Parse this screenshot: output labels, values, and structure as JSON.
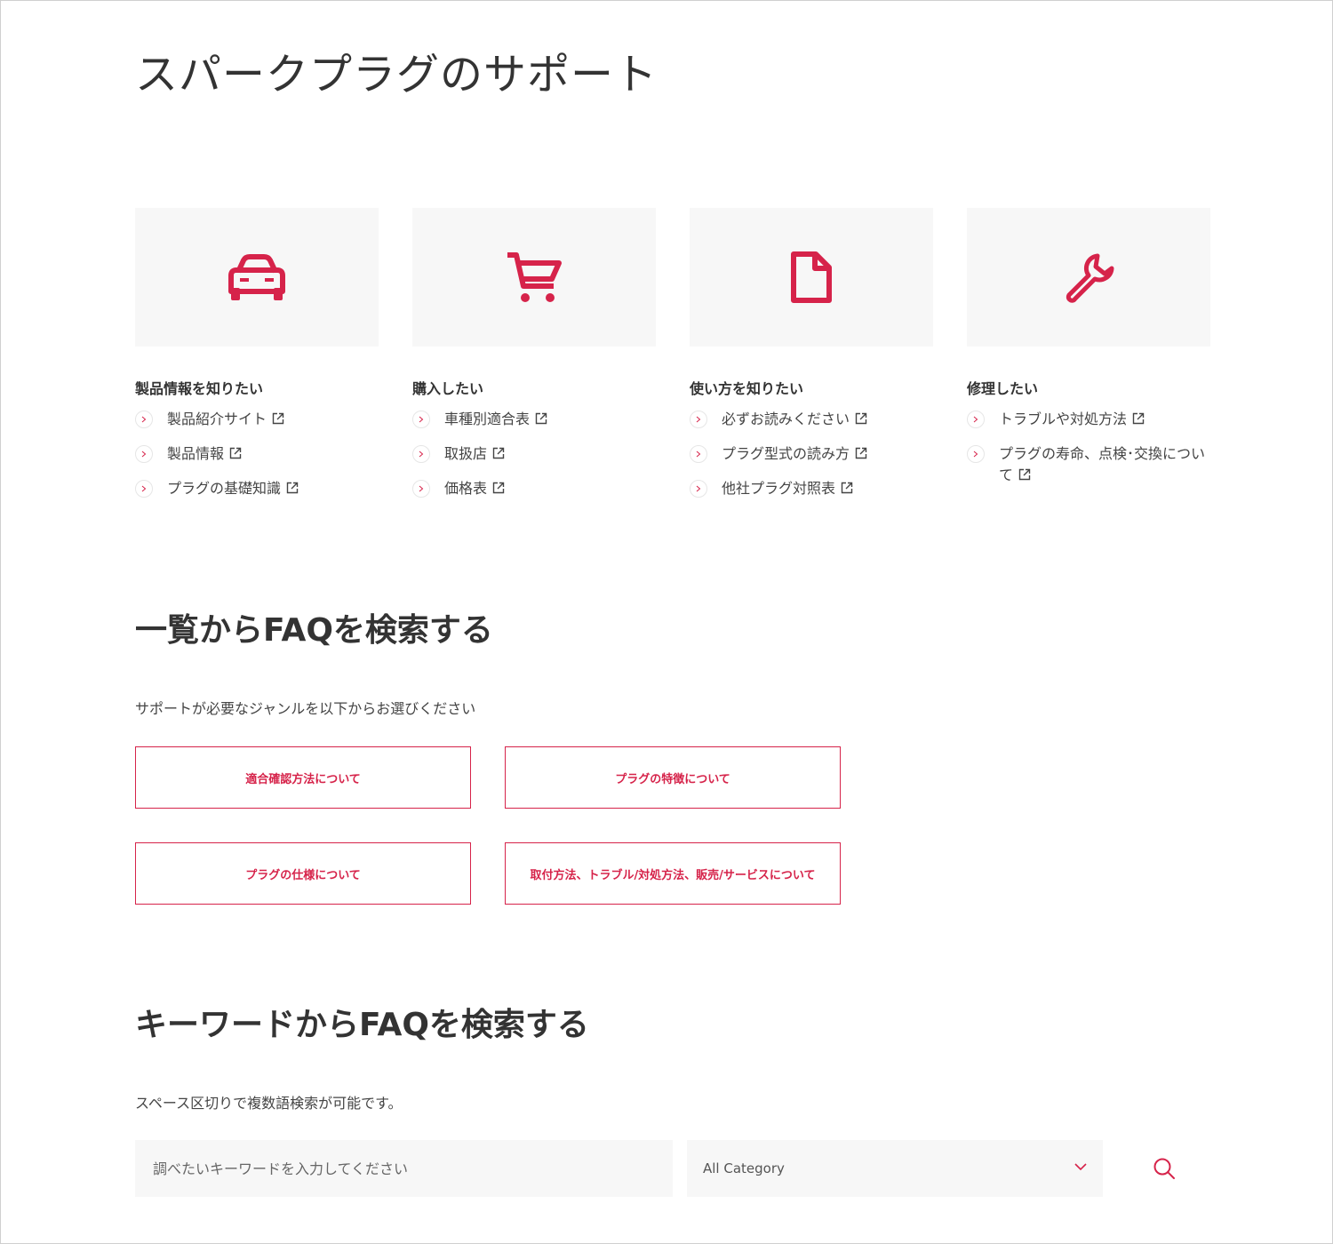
{
  "page": {
    "title": "スパークプラグのサポート"
  },
  "colors": {
    "accent": "#d6234a",
    "card_bg": "#f7f7f7",
    "text": "#333333"
  },
  "cards": [
    {
      "icon": "car-icon",
      "title": "製品情報を知りたい",
      "links": [
        "製品紹介サイト",
        "製品情報",
        "プラグの基礎知識"
      ]
    },
    {
      "icon": "cart-icon",
      "title": "購入したい",
      "links": [
        "車種別適合表",
        "取扱店",
        "価格表"
      ]
    },
    {
      "icon": "document-icon",
      "title": "使い方を知りたい",
      "links": [
        "必ずお読みください",
        "プラグ型式の読み方",
        "他社プラグ対照表"
      ]
    },
    {
      "icon": "wrench-icon",
      "title": "修理したい",
      "links": [
        "トラブルや対処方法",
        "プラグの寿命、点検･交換について"
      ]
    }
  ],
  "faq_list": {
    "title": "一覧からFAQを検索する",
    "description": "サポートが必要なジャンルを以下からお選びください",
    "buttons": [
      "適合確認方法について",
      "プラグの特徴について",
      "プラグの仕様について",
      "取付方法、トラブル/対処方法、販売/サービスについて"
    ]
  },
  "faq_keyword": {
    "title": "キーワードからFAQを検索する",
    "description": "スペース区切りで複数語検索が可能です。",
    "placeholder": "調べたいキーワードを入力してください",
    "category_value": "All Category",
    "search_icon": "search-icon",
    "dropdown_icon": "chevron-down-icon"
  }
}
